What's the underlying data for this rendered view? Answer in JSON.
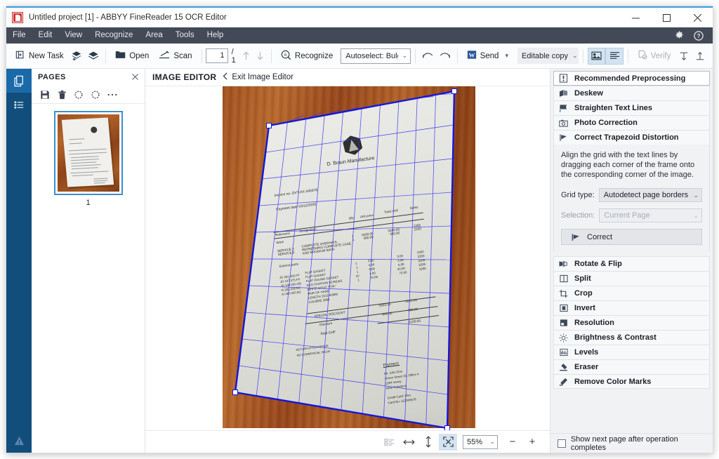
{
  "window": {
    "title": "Untitled project [1] - ABBYY FineReader 15 OCR Editor",
    "app_icon": "abbyy-logo-icon",
    "minimize": "minimize-icon",
    "maximize": "maximize-icon",
    "close": "close-icon",
    "accent_color": "#3c9cd8"
  },
  "menubar": {
    "items": [
      {
        "label": "File"
      },
      {
        "label": "Edit"
      },
      {
        "label": "View"
      },
      {
        "label": "Recognize"
      },
      {
        "label": "Area"
      },
      {
        "label": "Tools"
      },
      {
        "label": "Help"
      }
    ],
    "settings_icon": "gear-icon",
    "help_icon": "question-circle-icon",
    "background": "#434956"
  },
  "toolbar": {
    "new_task": "New Task",
    "add_pages_icon": "add-pages-icon",
    "layers_icon": "layers-icon",
    "open": "Open",
    "scan": "Scan",
    "page_current": "1",
    "page_total": "/ 1",
    "page_up_icon": "arrow-up-icon",
    "page_down_icon": "arrow-down-icon",
    "recognize": "Recognize",
    "language": "Autoselect: Bulgarian;",
    "undo_icon": "undo-icon",
    "redo_icon": "redo-icon",
    "send": "Send",
    "send_icon": "word-icon",
    "export_mode": "Editable copy",
    "view_image_icon": "image-view-icon",
    "view_text_icon": "text-view-icon",
    "verify": "Verify",
    "verify_icon": "verify-icon",
    "prev_error_icon": "previous-error-icon",
    "next_error_icon": "next-error-icon"
  },
  "rail": {
    "pages_icon": "pages-panel-icon",
    "list_icon": "list-panel-icon",
    "warning_icon": "warning-icon"
  },
  "pages_panel": {
    "title": "PAGES",
    "close_icon": "close-icon",
    "tools": [
      {
        "name": "save-icon",
        "glyph": "save"
      },
      {
        "name": "delete-icon",
        "glyph": "trash"
      },
      {
        "name": "rotate-left-icon",
        "glyph": "rotate-ccw"
      },
      {
        "name": "rotate-right-icon",
        "glyph": "rotate-cw"
      },
      {
        "name": "more-options-icon",
        "glyph": "ellipsis"
      }
    ],
    "thumbnails": [
      {
        "number": "1",
        "selected": true
      }
    ]
  },
  "editor": {
    "title": "IMAGE EDITOR",
    "exit_label": "Exit Image Editor",
    "back_icon": "chevron-left-icon"
  },
  "document_preview": {
    "header": "D. Braun Manufacture",
    "invoice_no": "Invoice no. DVT-AX-345678",
    "payment_date": "Payment date 03/12/2009",
    "columns": [
      "Reference",
      "Designation",
      "Qty",
      "Unit price",
      "Total CHF",
      "Swiss"
    ],
    "section_work": "Work",
    "work_rows": [
      {
        "ref": "SERVICE 2",
        "desc": "COMPLETE OVERHAUL",
        "qty": "1",
        "unit": "5500.00",
        "total": "5500.00",
        "vat": "2200"
      },
      {
        "ref": "SERVICE 0",
        "desc": "REFRESHING COMPLETE CASE",
        "qty": "1",
        "unit": "380.00",
        "total": "380.00",
        "vat": "2200"
      },
      {
        "ref": "",
        "desc": "AND RHODIUM BATH",
        "qty": "",
        "unit": "",
        "total": "",
        "vat": ""
      }
    ],
    "section_parts": "Exterior parts",
    "parts_rows": [
      {
        "ref": "JO 281.065.FP",
        "desc": "FLAT GASKET",
        "qty": "1",
        "unit": "3.00",
        "total": "3.00",
        "vat": "2200"
      },
      {
        "ref": "JO 197.375.FP",
        "desc": "FLAT GASKET",
        "qty": "1",
        "unit": "4.00",
        "total": "4.00",
        "vat": "2200"
      },
      {
        "ref": "JO 199.050.OB",
        "desc": "FLAT ROUND GASKET",
        "qty": "1",
        "unit": "6.00",
        "total": "6.00",
        "vat": "2200"
      },
      {
        "ref": "VI.281.036.BC",
        "desc": "REG FIXATION SCREWS",
        "qty": "10",
        "unit": "4.00",
        "total": "40.00",
        "vat": "2200"
      },
      {
        "ref": "AI 485.055.BC",
        "desc": "WHITE GOLD \"FOIL\"",
        "qty": "1",
        "unit": "70.00",
        "total": "70.00",
        "vat": "2200"
      },
      {
        "ref": "",
        "desc": "PAIR OF HAND",
        "qty": "",
        "unit": "",
        "total": "",
        "vat": ""
      },
      {
        "ref": "",
        "desc": "LENGTH 1013.50MM",
        "qty": "",
        "unit": "",
        "total": "",
        "vat": ""
      },
      {
        "ref": "",
        "desc": "CALIBRE 2899",
        "qty": "",
        "unit": "",
        "total": "",
        "vat": ""
      }
    ],
    "special_discount_label": "SPECIAL DISCOUNT",
    "special_discount_value": "-3003.00",
    "special_discount_value2": "-3003.00",
    "discount_label": "Discount",
    "discount_value": "-900.00",
    "discount_value2": "-900.00",
    "total_label": "Total CHF",
    "total_value": "2100.00",
    "note_1": "RETURN AFTER REPAIR",
    "note_2": "NO COMMERCIAL VALUE",
    "payment_title": "Payment:",
    "payment_lines": [
      "Mr. John Doe",
      "Green Street 15, Office 4",
      "1204 Vevey",
      "Near Coledona",
      "",
      "Credit Card: Visa",
      "Card No: 112345678"
    ],
    "grid_color": "#3030f0",
    "handle_count": 4
  },
  "zoombar": {
    "fit_page_icon": "fit-page-icon",
    "fit_width_icon": "fit-width-icon",
    "fit_height_icon": "fit-height-icon",
    "best_fit_icon": "best-fit-icon",
    "zoom_value": "55%",
    "zoom_out": "−",
    "zoom_in": "+"
  },
  "right_panel": {
    "tools": [
      {
        "label": "Recommended Preprocessing",
        "icon": "lightbulb-icon",
        "selected": true,
        "accel": "R"
      },
      {
        "label": "Deskew",
        "icon": "deskew-icon",
        "selected": false,
        "accel": "k"
      },
      {
        "label": "Straighten Text Lines",
        "icon": "straighten-icon",
        "selected": false,
        "accel": "T"
      },
      {
        "label": "Photo Correction",
        "icon": "camera-icon",
        "selected": false,
        "accel": "h"
      },
      {
        "label": "Correct Trapezoid Distortion",
        "icon": "trapezoid-icon",
        "selected": false,
        "accel": "z"
      }
    ],
    "expanded": {
      "description": "Align the grid with the text lines by dragging each corner of the frame onto the corresponding corner of the image.",
      "grid_type_label": "Grid type:",
      "grid_type_value": "Autodetect page borders",
      "selection_label": "Selection:",
      "selection_value": "Current Page",
      "correct_button": "Correct",
      "correct_icon": "trapezoid-icon"
    },
    "tools2": [
      {
        "label": "Rotate & Flip",
        "icon": "rotate-flip-icon",
        "accel": "o"
      },
      {
        "label": "Split",
        "icon": "split-icon",
        "accel": "li"
      },
      {
        "label": "Crop",
        "icon": "crop-icon",
        "accel": "C"
      },
      {
        "label": "Invert",
        "icon": "invert-icon",
        "accel": "v"
      },
      {
        "label": "Resolution",
        "icon": "resolution-icon",
        "accel": "u"
      },
      {
        "label": "Brightness & Contrast",
        "icon": "brightness-icon",
        "accel": "a"
      },
      {
        "label": "Levels",
        "icon": "levels-icon",
        "accel": "L"
      },
      {
        "label": "Eraser",
        "icon": "eraser-icon",
        "accel": "a"
      },
      {
        "label": "Remove Color Marks",
        "icon": "remove-color-icon",
        "accel": "M"
      }
    ],
    "footer_checkbox_label": "Show next page after operation completes",
    "footer_checkbox_checked": false
  }
}
